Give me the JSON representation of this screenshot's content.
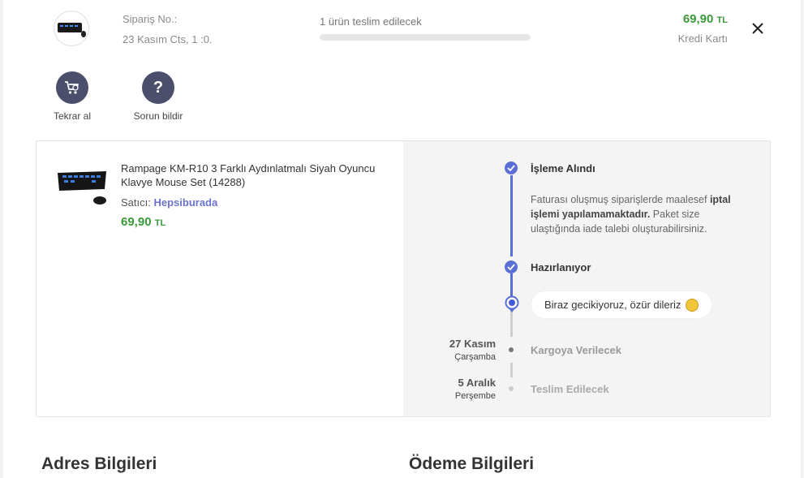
{
  "header": {
    "order_no_label": "Sipariş No.:",
    "order_date": "23 Kasım Cts, 1 :0.",
    "delivery_status": "1 ürün teslim edilecek",
    "progress": 0,
    "price": "69,90",
    "currency": "TL",
    "payment_method": "Kredi Kartı",
    "close_label": "×"
  },
  "actions": [
    {
      "label": "Tekrar al",
      "icon": "cart-reorder-icon"
    },
    {
      "label": "Sorun bildir",
      "icon": "question-icon"
    }
  ],
  "product": {
    "name": "Rampage KM-R10 3 Farklı Aydınlatmalı Siyah Oyuncu Klavye Mouse Set (14288)",
    "seller_label": "Satıcı:",
    "seller_name": "Hepsiburada",
    "price": "69,90",
    "currency": "TL"
  },
  "timeline": {
    "steps": [
      {
        "title": "İşleme Alındı",
        "state": "done"
      },
      {
        "title": "Hazırlanıyor",
        "state": "done"
      },
      {
        "title": "Kargoya Verilecek",
        "state": "pending",
        "date": "27 Kasım",
        "weekday": "Çarşamba"
      },
      {
        "title": "Teslim Edilecek",
        "state": "pending",
        "date": "5 Aralık",
        "weekday": "Perşembe"
      }
    ],
    "info_text_1": "Faturası oluşmuş siparişlerde maalesef ",
    "info_bold": "iptal işlemi yapılamamaktadır.",
    "info_text_2": " Paket size ulaştığında iade talebi oluşturabilirsiniz.",
    "delay_message": "Biraz gecikiyoruz, özür dileriz"
  },
  "sections": {
    "address_title": "Adres Bilgileri",
    "payment_title": "Ödeme Bilgileri"
  },
  "colors": {
    "accent": "#5a6fd6",
    "price_green": "#3a9a3a",
    "seller_link": "#6a73c9",
    "action_circle": "#4b4f6b"
  }
}
